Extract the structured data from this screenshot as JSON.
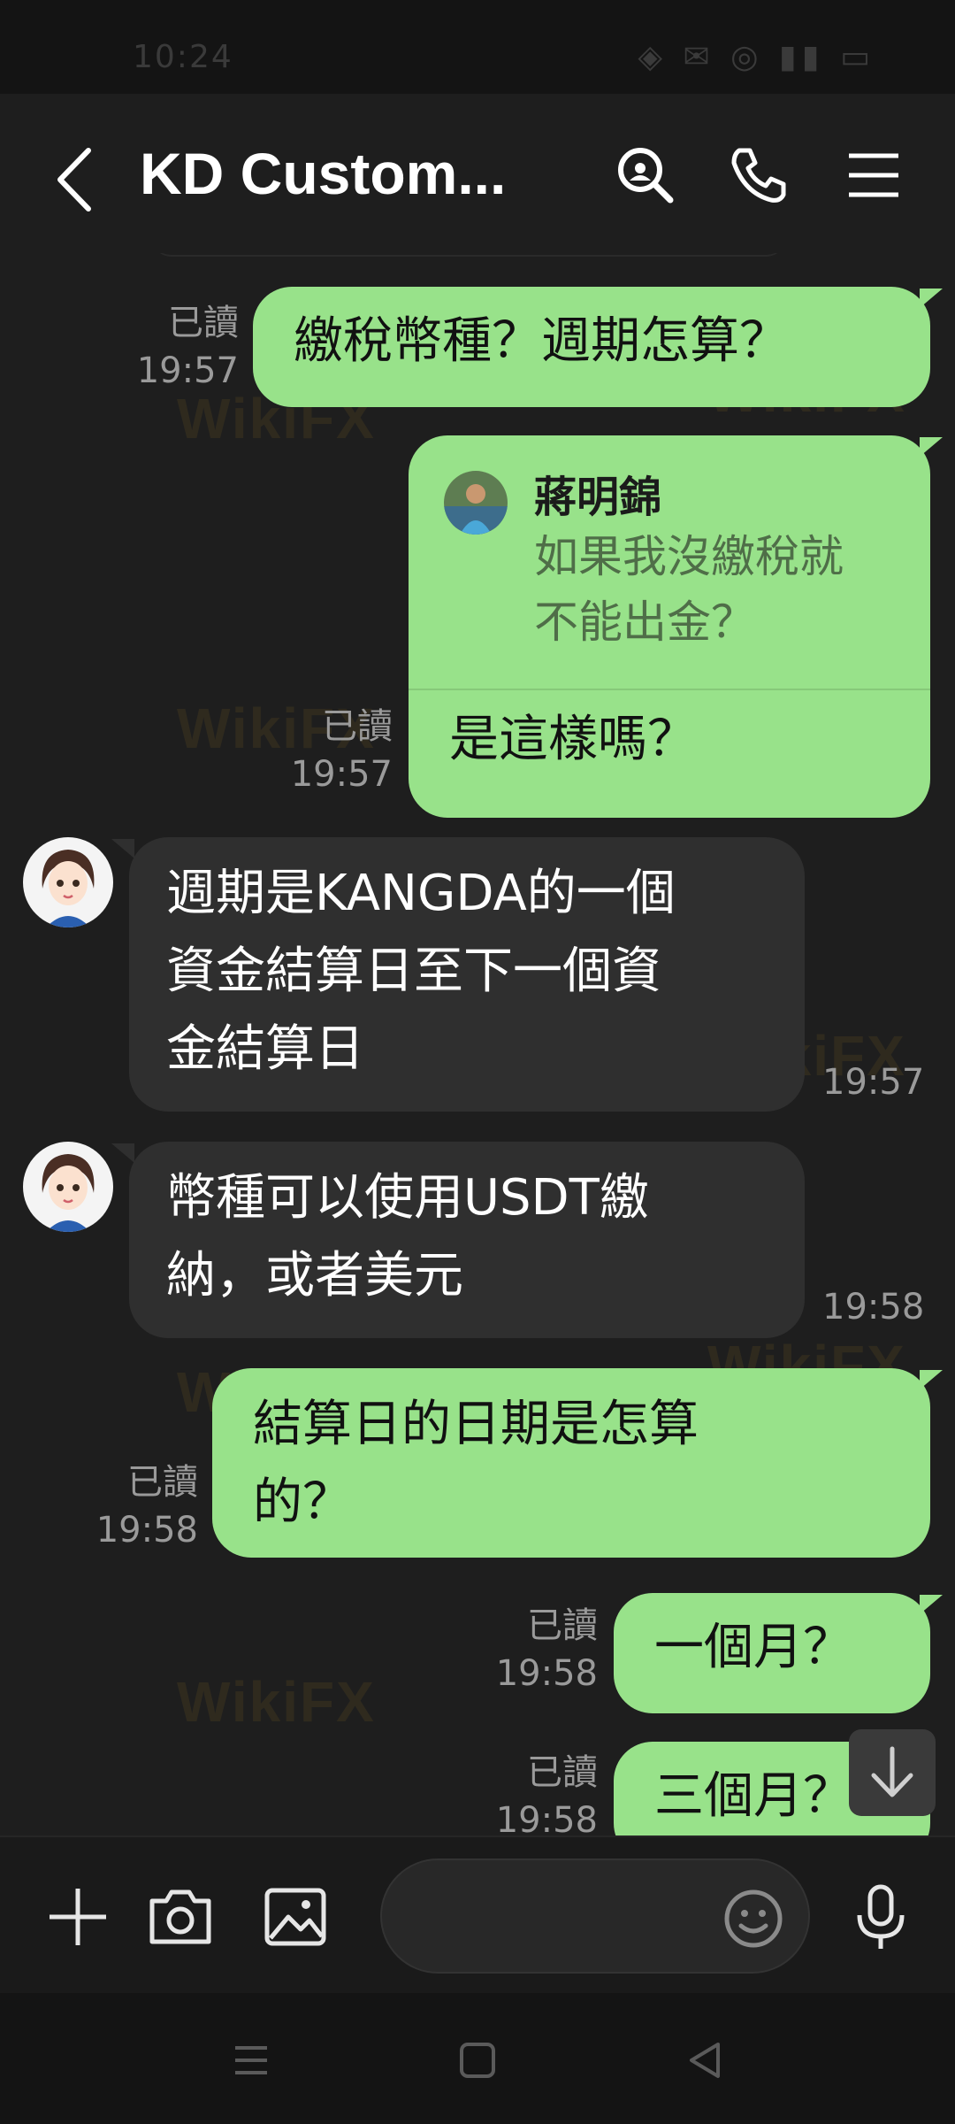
{
  "status_bar": {
    "time": "10:24",
    "indicators": "◈ ✉ ◎ ▮▮ ▭"
  },
  "header": {
    "title": "KD Custom..."
  },
  "watermark": "WikiFX",
  "messages": [
    {
      "type": "sent",
      "read": "已讀",
      "time": "19:57",
      "text": "繳稅幣種？週期怎算？"
    },
    {
      "type": "sent_reply",
      "read": "已讀",
      "time": "19:57",
      "reply": {
        "name": "蔣明錦",
        "text": "如果我沒繳稅就\n不能出金？"
      },
      "text": "是這樣嗎？"
    },
    {
      "type": "received",
      "time": "19:57",
      "text": "週期是KANGDA的一個\n資金結算日至下一個資\n金結算日"
    },
    {
      "type": "received",
      "time": "19:58",
      "text": "幣種可以使用USDT繳\n納，或者美元"
    },
    {
      "type": "sent",
      "read": "已讀",
      "time": "19:58",
      "text": "結算日的日期是怎算\n的？"
    },
    {
      "type": "sent",
      "read": "已讀",
      "time": "19:58",
      "text": "一個月？"
    },
    {
      "type": "sent",
      "read": "已讀",
      "time": "19:58",
      "text": "三個月？"
    }
  ],
  "input": {
    "placeholder": ""
  },
  "colors": {
    "sent_bubble": "#98e28a",
    "received_bubble": "#2f2f2f",
    "background": "#1e1e1e"
  }
}
